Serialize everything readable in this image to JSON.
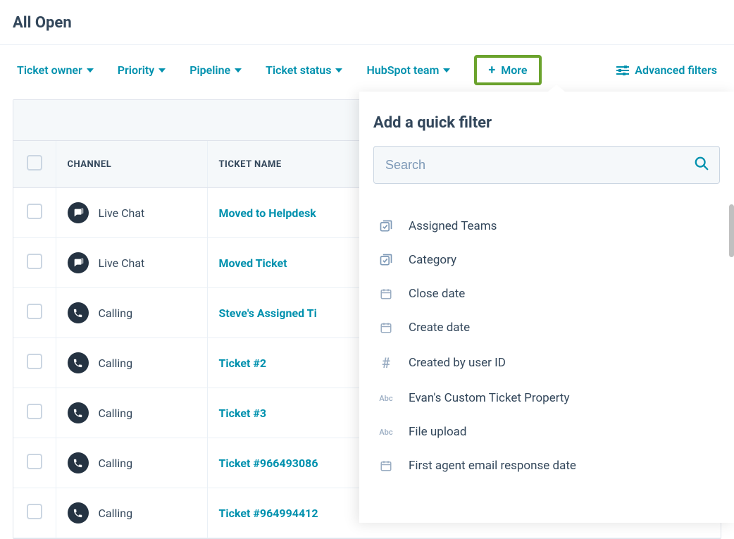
{
  "header": {
    "title": "All Open"
  },
  "filters": {
    "owner": "Ticket owner",
    "priority": "Priority",
    "pipeline": "Pipeline",
    "status": "Ticket status",
    "team": "HubSpot team",
    "more": "More",
    "advanced": "Advanced filters"
  },
  "table": {
    "columns": {
      "channel": "Channel",
      "ticket_name": "Ticket Name"
    },
    "rows": [
      {
        "channel_icon": "chat",
        "channel": "Live Chat",
        "name": "Moved to Helpdesk"
      },
      {
        "channel_icon": "chat",
        "channel": "Live Chat",
        "name": "Moved Ticket"
      },
      {
        "channel_icon": "phone",
        "channel": "Calling",
        "name": "Steve's Assigned Ti"
      },
      {
        "channel_icon": "phone",
        "channel": "Calling",
        "name": "Ticket #2"
      },
      {
        "channel_icon": "phone",
        "channel": "Calling",
        "name": "Ticket #3"
      },
      {
        "channel_icon": "phone",
        "channel": "Calling",
        "name": "Ticket #966493086"
      },
      {
        "channel_icon": "phone",
        "channel": "Calling",
        "name": "Ticket #964994412"
      }
    ]
  },
  "popover": {
    "title": "Add a quick filter",
    "search_placeholder": "Search",
    "options": [
      {
        "icon": "multiselect",
        "label": "Assigned Teams"
      },
      {
        "icon": "multiselect",
        "label": "Category"
      },
      {
        "icon": "date",
        "label": "Close date"
      },
      {
        "icon": "date",
        "label": "Create date"
      },
      {
        "icon": "hash",
        "label": "Created by user ID"
      },
      {
        "icon": "abc",
        "label": "Evan's Custom Ticket Property"
      },
      {
        "icon": "abc",
        "label": "File upload"
      },
      {
        "icon": "date",
        "label": "First agent email response date"
      }
    ]
  }
}
